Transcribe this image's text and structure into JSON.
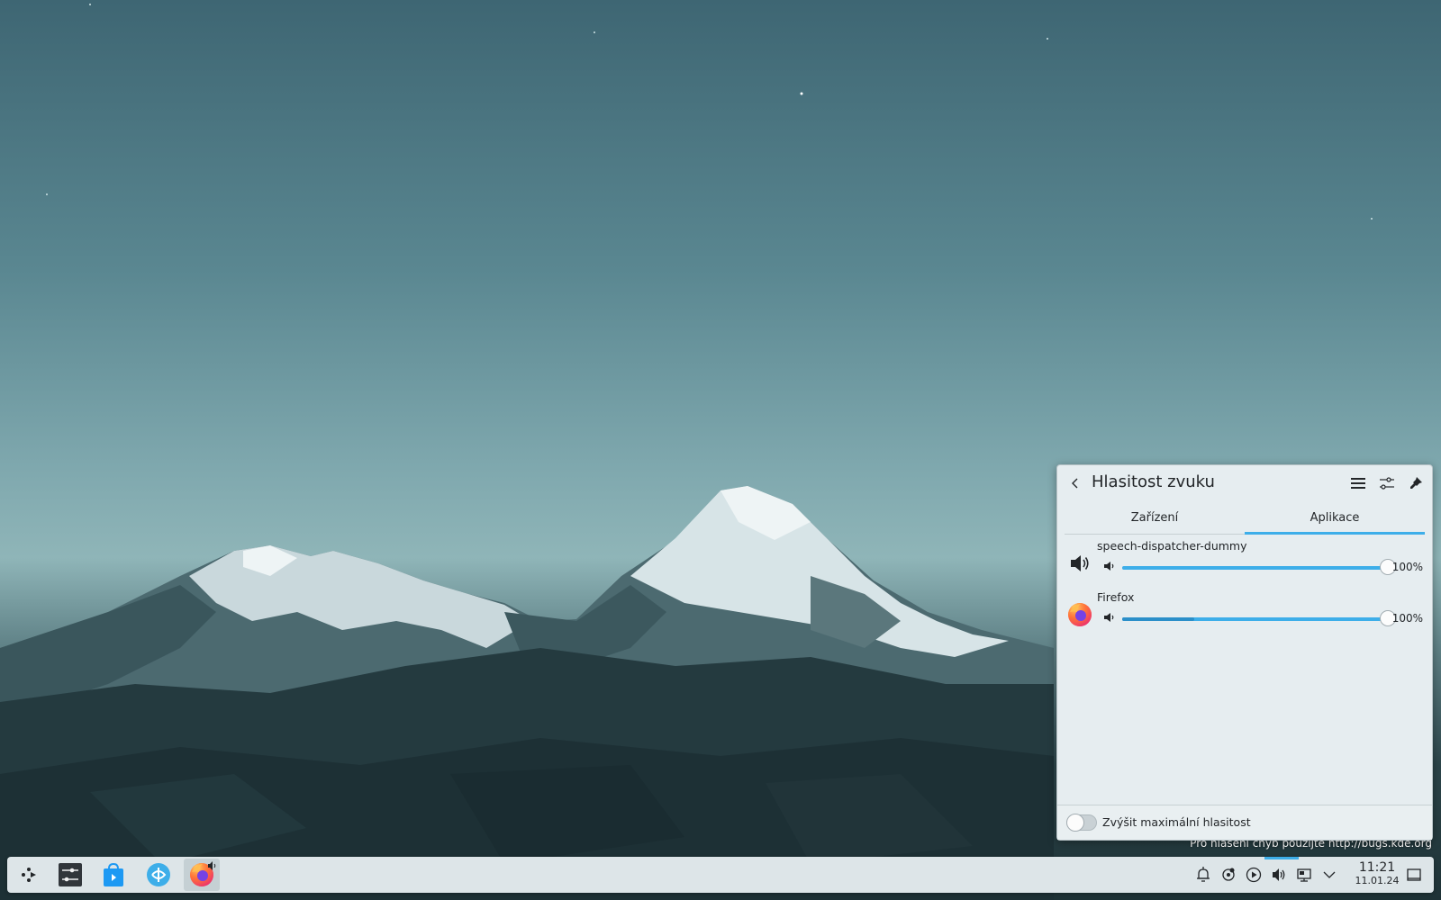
{
  "desktop": {
    "bug_notice": "Pro hlášení chyb použijte http://bugs.kde.org"
  },
  "popup": {
    "title": "Hlasitost zvuku",
    "tabs": [
      {
        "label": "Zařízení",
        "active": false
      },
      {
        "label": "Aplikace",
        "active": true
      }
    ],
    "apps": [
      {
        "name": "speech-dispatcher-dummy",
        "icon": "speaker-icon",
        "volume_label": "100%",
        "volume": 1.0,
        "peak": 0.0
      },
      {
        "name": "Firefox",
        "icon": "firefox-icon",
        "volume_label": "100%",
        "volume": 1.0,
        "peak": 0.27
      }
    ],
    "footer": {
      "boost_label": "Zvýšit maximální hlasitost",
      "boost_enabled": false
    }
  },
  "taskbar": {
    "launchers": [
      "application-launcher-icon",
      "system-settings-icon",
      "discover-store-icon",
      "kde-connect-icon",
      "firefox-icon"
    ],
    "tray": [
      "notifications-icon",
      "updates-icon",
      "media-player-icon",
      "volume-icon",
      "network-icon",
      "expand-tray-icon"
    ],
    "clock": {
      "time": "11:21",
      "date": "11.01.24"
    }
  },
  "colors": {
    "accent": "#3daee9",
    "panel_bg": "#dde5e8",
    "popup_bg": "#e6edf0"
  }
}
